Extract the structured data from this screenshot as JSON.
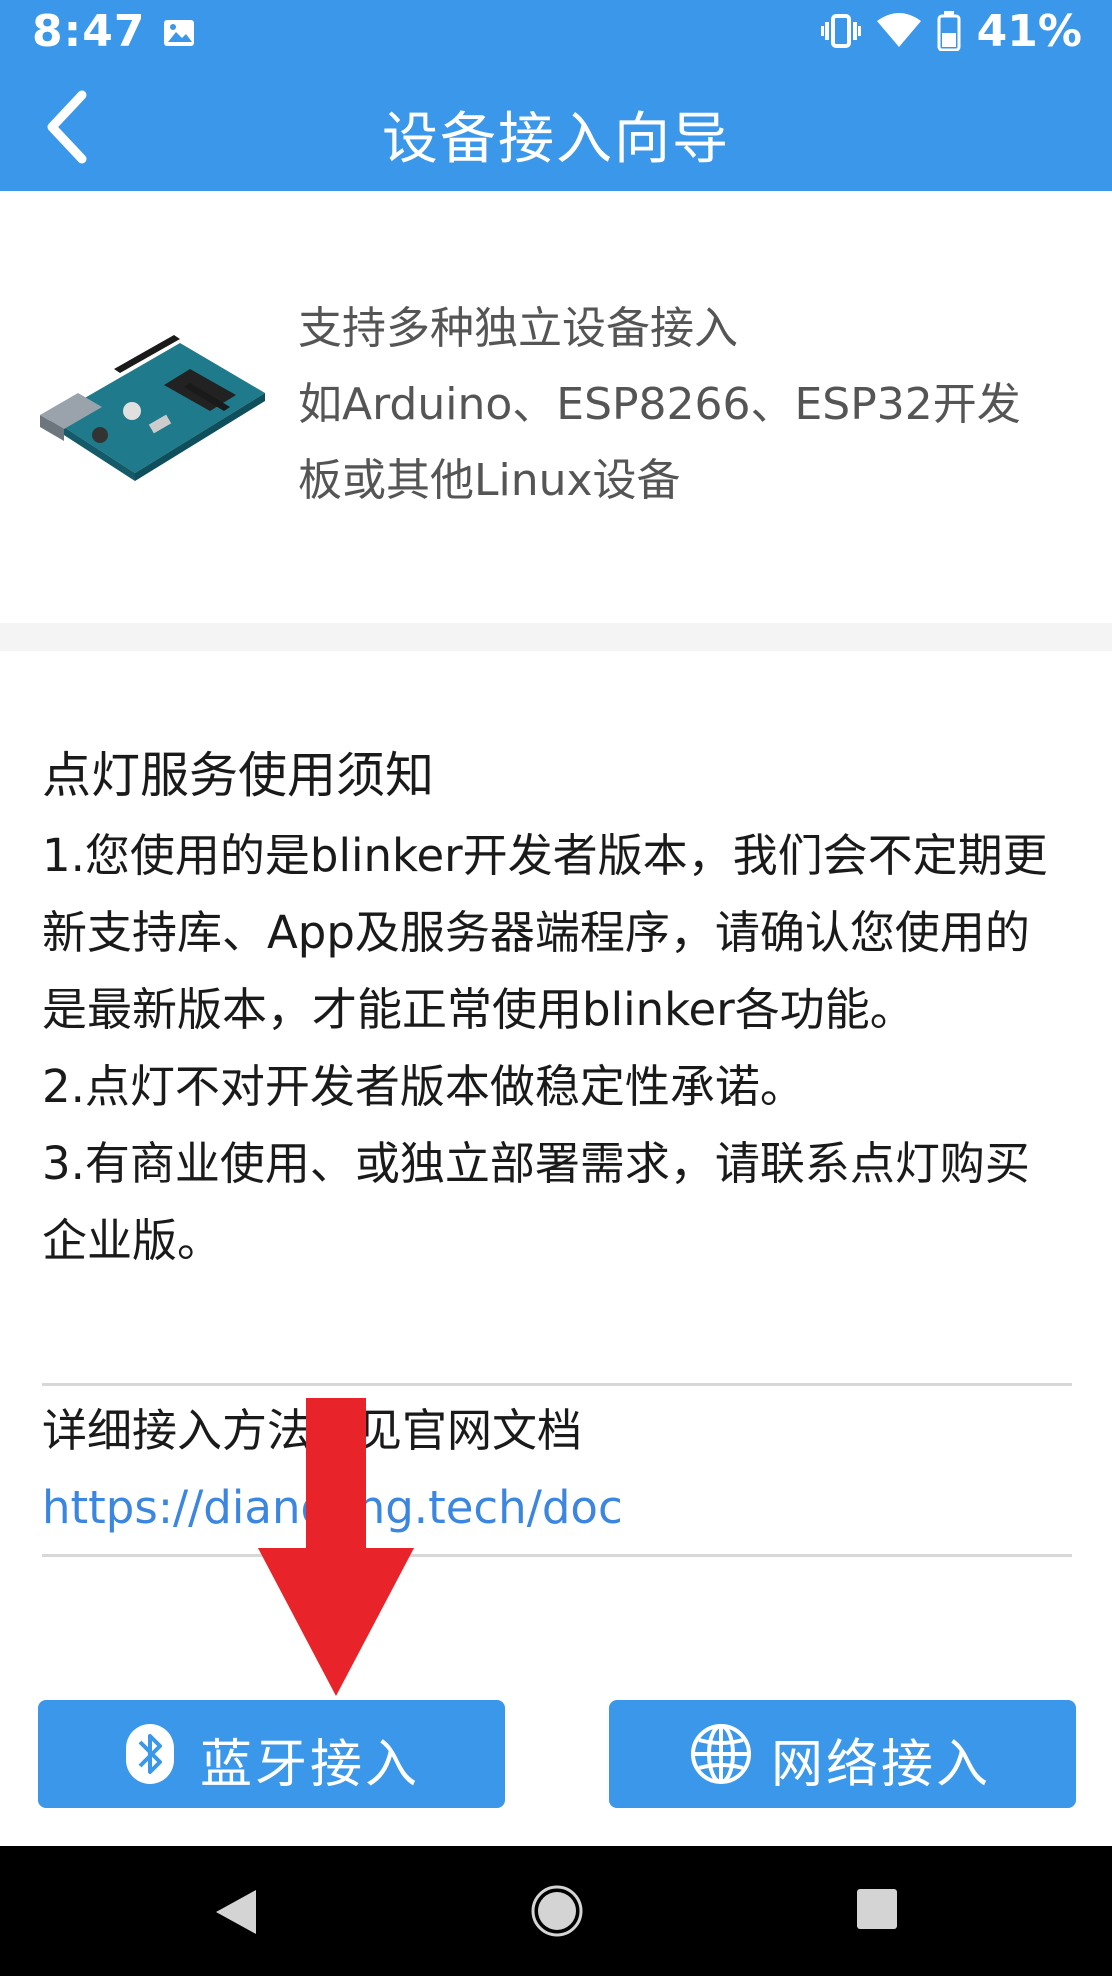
{
  "status_bar": {
    "time": "8:47",
    "battery": "41%",
    "icons": [
      "image-icon",
      "vibrate-icon",
      "wifi-icon",
      "battery-icon"
    ]
  },
  "app_bar": {
    "title": "设备接入向导",
    "back_icon": "back-chevron-icon"
  },
  "intro": {
    "lines": [
      "支持多种独立设备接入",
      "如Arduino、ESP8266、ESP32开发",
      "板或其他Linux设备"
    ]
  },
  "notice": {
    "title": "点灯服务使用须知",
    "items": [
      "1.您使用的是blinker开发者版本，我们会不定期更新支持库、App及服务器端程序，请确认您使用的是最新版本，才能正常使用blinker各功能。",
      "2.点灯不对开发者版本做稳定性承诺。",
      "3.有商业使用、或独立部署需求，请联系点灯购买企业版。"
    ]
  },
  "docs": {
    "label": "详细接入方法可见官网文档",
    "link": "https://diandeng.tech/doc"
  },
  "buttons": {
    "bluetooth": {
      "label": "蓝牙接入",
      "icon": "bluetooth-icon"
    },
    "network": {
      "label": "网络接入",
      "icon": "globe-icon"
    }
  },
  "colors": {
    "primary": "#3b97ea",
    "link": "#3b86e0",
    "arrow": "#e8232a",
    "nav_bar": "#000000"
  }
}
